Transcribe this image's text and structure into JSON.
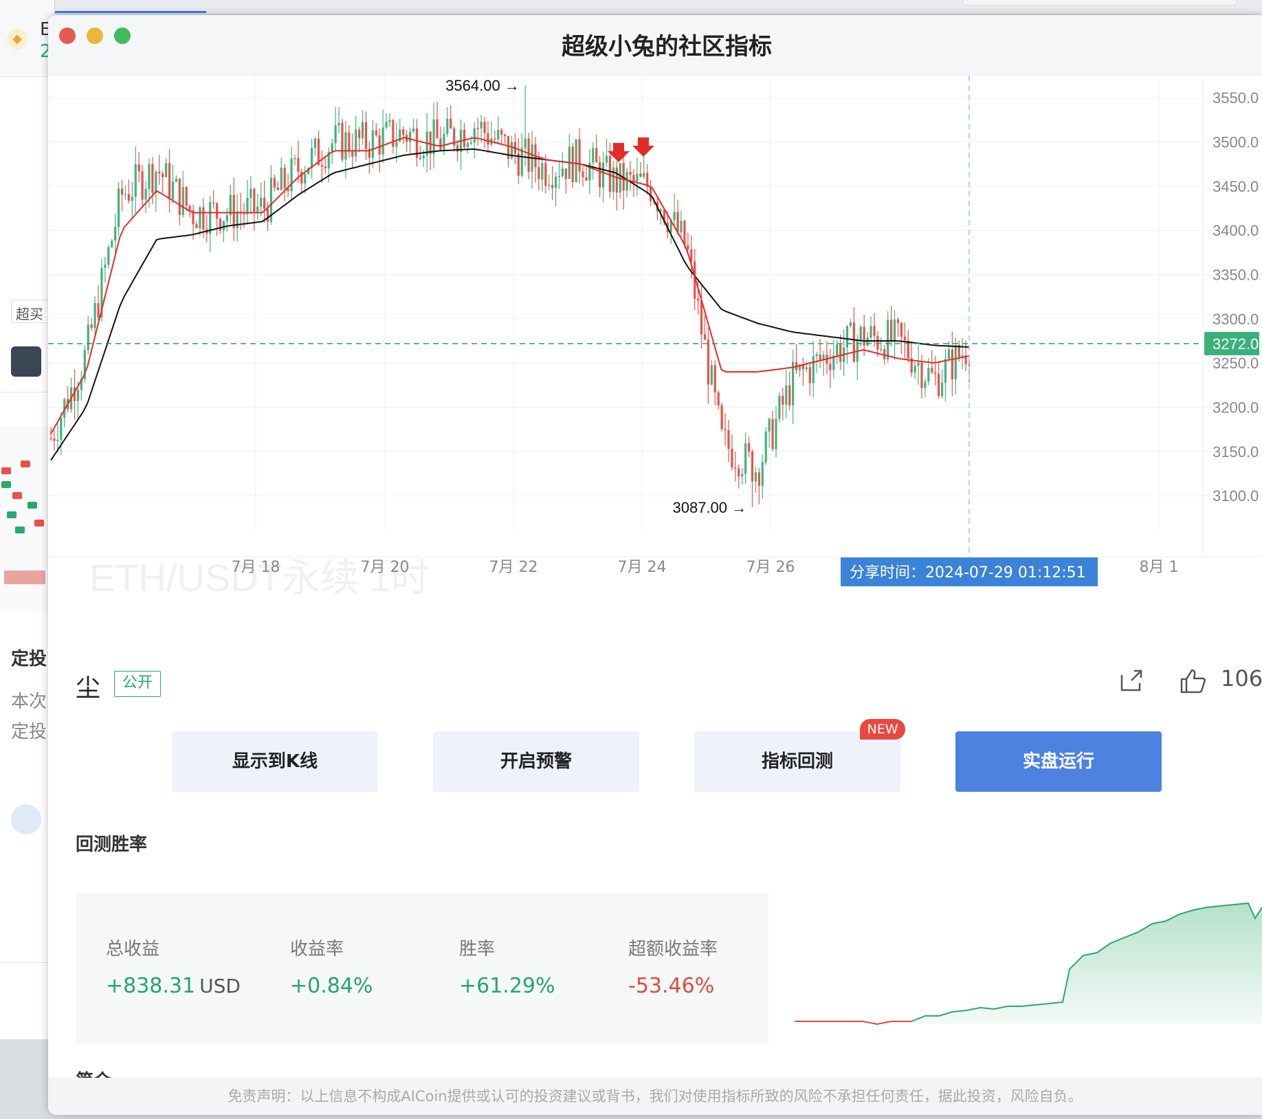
{
  "window": {
    "title": "超级小兔的社区指标",
    "traffic": {
      "close": "#e55b54",
      "minimize": "#e8b83a",
      "zoom": "#3fbd5d"
    }
  },
  "background": {
    "logo_icon": "binance-logo-icon",
    "text_lines": [
      "E",
      "2"
    ],
    "chip_label": "超买",
    "section_label": "定投",
    "desc_lines": [
      "本次",
      "定投"
    ]
  },
  "chart": {
    "watermark": "ETH/USDT永续 1时",
    "high_label": "3564.00 →",
    "low_label": "3087.00 →",
    "current_price": "3272.0",
    "share_time": "分享时间：2024-07-29 01:12:51",
    "y_ticks": [
      "3550.0",
      "3500.0",
      "3450.0",
      "3400.0",
      "3350.0",
      "3300.0",
      "3250.0",
      "3200.0",
      "3150.0",
      "3100.0"
    ],
    "x_ticks": [
      "7月 18",
      "7月 20",
      "7月 22",
      "7月 24",
      "7月 26",
      "8月 1"
    ],
    "colors": {
      "up": "#3fb37f",
      "down": "#e8524a",
      "ma_fast": "#e42b26",
      "ma_slow": "#111111",
      "price_line": "#2a9d63",
      "time_line": "#9cc3ee",
      "share_bg": "#3b82d9"
    }
  },
  "chart_data": {
    "type": "candlestick",
    "symbol": "ETH/USDT永续",
    "interval": "1时",
    "ylim": [
      3062,
      3575
    ],
    "y_ticks": [
      3550,
      3500,
      3450,
      3400,
      3350,
      3300,
      3250,
      3200,
      3150,
      3100
    ],
    "x_ticks": [
      "7月 18",
      "7月 20",
      "7月 22",
      "7月 24",
      "7月 26",
      "8月 1"
    ],
    "high": 3564.0,
    "low": 3087.0,
    "current_price": 3272.0,
    "close_path_points": [
      [
        "7月 16 12:00",
        3165
      ],
      [
        "7月 17 00:00",
        3260
      ],
      [
        "7月 17 12:00",
        3440
      ],
      [
        "7月 18 00:00",
        3470
      ],
      [
        "7月 18 12:00",
        3420
      ],
      [
        "7月 19 00:00",
        3420
      ],
      [
        "7月 19 12:00",
        3425
      ],
      [
        "7月 20 00:00",
        3470
      ],
      [
        "7月 20 12:00",
        3500
      ],
      [
        "7月 21 00:00",
        3500
      ],
      [
        "7月 21 12:00",
        3510
      ],
      [
        "7月 22 00:00",
        3500
      ],
      [
        "7月 22 12:00",
        3520
      ],
      [
        "7月 23 00:00",
        3490
      ],
      [
        "7月 23 12:00",
        3470
      ],
      [
        "7月 24 00:00",
        3480
      ],
      [
        "7月 24 12:00",
        3455
      ],
      [
        "7月 25 00:00",
        3450
      ],
      [
        "7月 25 12:00",
        3380
      ],
      [
        "7月 25 18:00",
        3160
      ],
      [
        "7月 26 00:00",
        3130
      ],
      [
        "7月 26 12:00",
        3230
      ],
      [
        "7月 27 00:00",
        3260
      ],
      [
        "7月 27 12:00",
        3280
      ],
      [
        "7月 28 00:00",
        3275
      ],
      [
        "7月 28 12:00",
        3230
      ],
      [
        "7月 29 00:00",
        3270
      ]
    ],
    "ma_fast_points": [
      [
        3170
      ],
      [
        3240
      ],
      [
        3400
      ],
      [
        3445
      ],
      [
        3420
      ],
      [
        3420
      ],
      [
        3420
      ],
      [
        3460
      ],
      [
        3490
      ],
      [
        3490
      ],
      [
        3505
      ],
      [
        3495
      ],
      [
        3505
      ],
      [
        3495
      ],
      [
        3480
      ],
      [
        3475
      ],
      [
        3460
      ],
      [
        3450
      ],
      [
        3380
      ],
      [
        3240
      ],
      [
        3240
      ],
      [
        3245
      ],
      [
        3255
      ],
      [
        3265
      ],
      [
        3255
      ],
      [
        3250
      ],
      [
        3258
      ]
    ],
    "ma_slow_points": [
      [
        3140
      ],
      [
        3200
      ],
      [
        3320
      ],
      [
        3390
      ],
      [
        3395
      ],
      [
        3405
      ],
      [
        3410
      ],
      [
        3440
      ],
      [
        3465
      ],
      [
        3475
      ],
      [
        3485
      ],
      [
        3490
      ],
      [
        3492
      ],
      [
        3485
      ],
      [
        3480
      ],
      [
        3475
      ],
      [
        3465
      ],
      [
        3440
      ],
      [
        3360
      ],
      [
        3310
      ],
      [
        3295
      ],
      [
        3285
      ],
      [
        3280
      ],
      [
        3275
      ],
      [
        3275
      ],
      [
        3270
      ],
      [
        3268
      ]
    ],
    "signals": [
      "7月 23 12:00",
      "7月 23 20:00"
    ]
  },
  "post": {
    "author": "尘",
    "visibility": "公开",
    "share_icon": "share-icon",
    "like_icon": "thumb-up-icon",
    "likes": "106"
  },
  "buttons": {
    "show_kline": "显示到K线",
    "alert": "开启预警",
    "backtest": "指标回测",
    "backtest_badge": "NEW",
    "live": "实盘运行"
  },
  "backtest": {
    "title": "回测胜率",
    "total_label": "总收益",
    "total_value": "+838.31",
    "total_unit": "USD",
    "rate_label": "收益率",
    "rate_value": "+0.84%",
    "win_label": "胜率",
    "win_value": "+61.29%",
    "excess_label": "超额收益率",
    "excess_value": "-53.46%",
    "next_section": "简介"
  },
  "disclaimer": "免责声明：以上信息不构成AICoin提供或认可的投资建议或背书，我们对使用指标所致的风险不承担任何责任，据此投资，风险自负。"
}
